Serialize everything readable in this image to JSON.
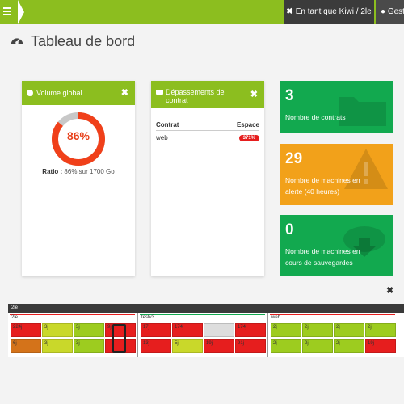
{
  "topbar": {
    "user_label": "En tant que Kiwi / 2le",
    "manage_label": "Gest"
  },
  "page": {
    "title": "Tableau de bord"
  },
  "volume_panel": {
    "title": "Volume global",
    "percent_label": "86%",
    "usage_fraction": 0.86,
    "ratio_label": "Ratio :",
    "ratio_value": "86% sur 1700 Go"
  },
  "overrun_panel": {
    "title": "Dépassements de contrat",
    "columns": [
      "Contrat",
      "Espace"
    ],
    "rows": [
      {
        "contract": "web",
        "space": "371%"
      }
    ]
  },
  "tiles": [
    {
      "value": "3",
      "label": "Nombre de contrats",
      "color": "#12a94f",
      "icon": "folder-icon"
    },
    {
      "value": "29",
      "label": "Nombre de machines en alerte (40 heures)",
      "color": "#f2a11a",
      "icon": "warning-icon"
    },
    {
      "value": "0",
      "label": "Nombre de machines en cours de sauvegardes",
      "color": "#12a94f",
      "icon": "download-icon"
    }
  ],
  "machines_band": {
    "header": "2le",
    "groups": [
      {
        "name": "2le",
        "bar_color": "#e61e1e",
        "cells": [
          {
            "label": "224j",
            "color": "#e61e1e"
          },
          {
            "label": "3j",
            "color": "#c9d82a"
          },
          {
            "label": "3j",
            "color": "#9dcc1f"
          },
          {
            "label": "9j",
            "color": "#e61e1e"
          },
          {
            "label": "6j",
            "color": "#d4731a"
          },
          {
            "label": "3j",
            "color": "#c9d82a"
          },
          {
            "label": "3j",
            "color": "#9dcc1f"
          },
          {
            "label": "",
            "color": "#e61e1e"
          }
        ]
      },
      {
        "name": "testv3",
        "bar_color": "#12a94f",
        "cells": [
          {
            "label": "17j",
            "color": "#e61e1e"
          },
          {
            "label": "174j",
            "color": "#e61e1e"
          },
          {
            "label": "",
            "color": "#dddddd"
          },
          {
            "label": "174j",
            "color": "#e61e1e"
          },
          {
            "label": "13j",
            "color": "#e61e1e"
          },
          {
            "label": "5j",
            "color": "#c9d82a"
          },
          {
            "label": "19j",
            "color": "#e61e1e"
          },
          {
            "label": "91j",
            "color": "#e61e1e"
          }
        ]
      },
      {
        "name": "web",
        "bar_color": "#e61e1e",
        "cells": [
          {
            "label": "2j",
            "color": "#9dcc1f"
          },
          {
            "label": "2j",
            "color": "#9dcc1f"
          },
          {
            "label": "2j",
            "color": "#9dcc1f"
          },
          {
            "label": "2j",
            "color": "#9dcc1f"
          },
          {
            "label": "2j",
            "color": "#9dcc1f"
          },
          {
            "label": "2j",
            "color": "#9dcc1f"
          },
          {
            "label": "2j",
            "color": "#9dcc1f"
          },
          {
            "label": "19j",
            "color": "#e61e1e"
          }
        ]
      }
    ]
  },
  "colors": {
    "brand": "#8cbe1f",
    "dark": "#3b3b3b",
    "alert": "#e61e1e"
  }
}
